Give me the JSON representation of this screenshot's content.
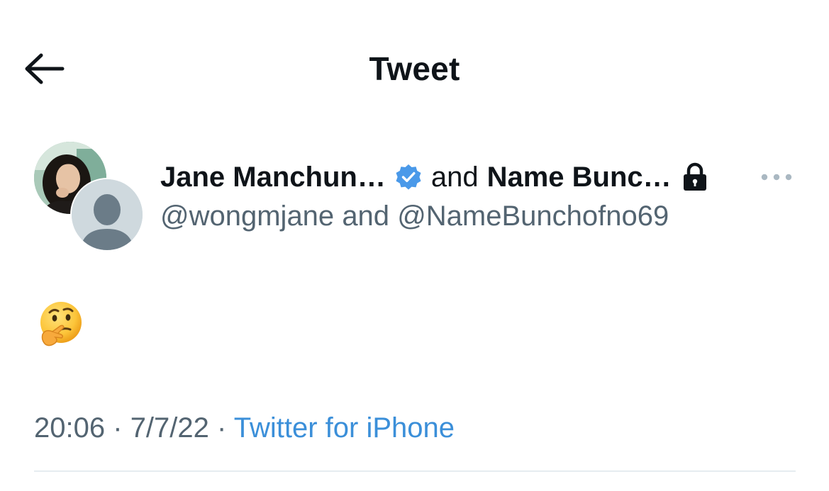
{
  "header": {
    "title": "Tweet",
    "back_icon": "arrow-left-icon"
  },
  "tweet": {
    "authors": [
      {
        "display_name": "Jane Manchun…",
        "handle": "@wongmjane",
        "verified": true,
        "protected": false
      },
      {
        "display_name": "Name Bunc…",
        "handle": "@NameBunchofno69",
        "verified": false,
        "protected": true
      }
    ],
    "joiner": "and",
    "handles_joiner": "and",
    "more_icon": "ellipsis-icon",
    "content_emoji": "thinking-face",
    "time": "20:06",
    "date": "7/7/22",
    "separator": "·",
    "source": "Twitter for iPhone"
  },
  "colors": {
    "text_primary": "#0f1419",
    "text_secondary": "#536471",
    "link": "#3b8fd9",
    "verified": "#4a99e9",
    "divider": "#e6ecf0",
    "placeholder_avatar": "#cfd9de",
    "placeholder_silhouette": "#6b7c88"
  }
}
